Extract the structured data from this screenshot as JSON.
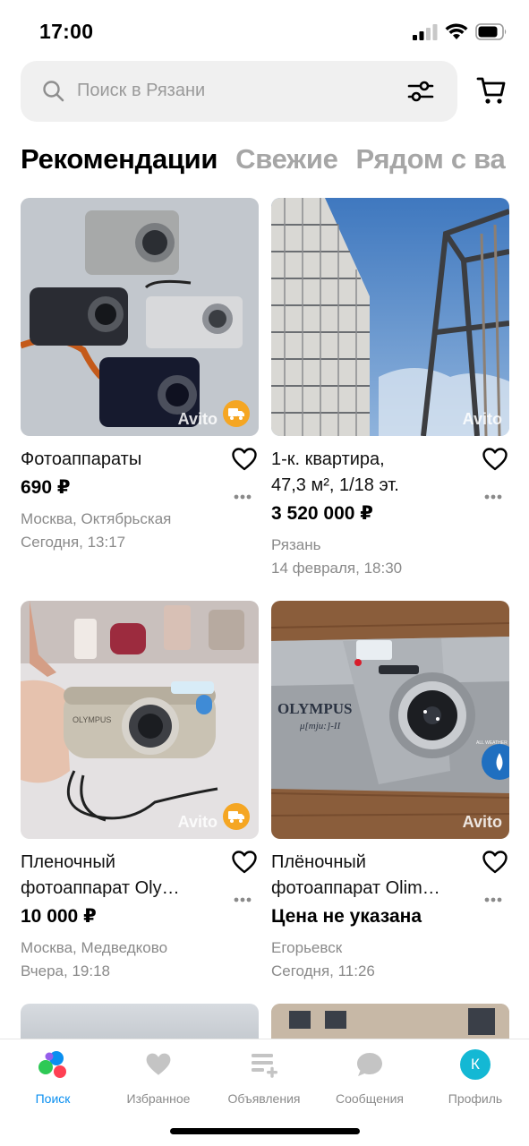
{
  "status_bar": {
    "time": "17:00"
  },
  "search": {
    "placeholder": "Поиск в Рязани"
  },
  "tabs": [
    {
      "label": "Рекомендации",
      "active": true
    },
    {
      "label": "Свежие",
      "active": false
    },
    {
      "label": "Рядом с ва",
      "active": false
    }
  ],
  "listings": [
    {
      "title_lines": [
        "Фотоаппараты"
      ],
      "price": "690 ₽",
      "location": "Москва, Октябрьская",
      "date": "Сегодня, 13:17",
      "delivery": true,
      "watermark": "Avito"
    },
    {
      "title_lines": [
        "1-к. квартира,",
        "47,3 м², 1/18 эт."
      ],
      "price": "3 520 000 ₽",
      "location": "Рязань",
      "date": "14 февраля, 18:30",
      "delivery": false,
      "watermark": "Avito"
    },
    {
      "title_lines": [
        "Пленочный",
        "фотоаппарат Oly…"
      ],
      "price": "10 000 ₽",
      "location": "Москва, Медведково",
      "date": "Вчера, 19:18",
      "delivery": true,
      "watermark": "Avito",
      "camera_brand": "OLYMPUS"
    },
    {
      "title_lines": [
        "Плёночный",
        "фотоаппарат Olim…"
      ],
      "price": "Цена не указана",
      "location": "Егорьевск",
      "date": "Сегодня, 11:26",
      "delivery": false,
      "watermark": "Avito",
      "camera_brand": "OLYMPUS",
      "camera_model": "μ[mju:]-II",
      "camera_badge": "ALL WEATHER"
    }
  ],
  "bottom_nav": [
    {
      "label": "Поиск",
      "icon": "search-dots-icon",
      "active": true
    },
    {
      "label": "Избранное",
      "icon": "heart-icon",
      "active": false
    },
    {
      "label": "Объявления",
      "icon": "listings-add-icon",
      "active": false
    },
    {
      "label": "Сообщения",
      "icon": "chat-bubble-icon",
      "active": false
    },
    {
      "label": "Профиль",
      "icon": "avatar",
      "active": false,
      "avatar_letter": "К"
    }
  ],
  "colors": {
    "accent_blue": "#0a8ff0",
    "delivery_orange": "#f5a623",
    "muted_text": "#8a8a8a",
    "search_bg": "#f0f0f0",
    "profile_avatar": "#14b8d4"
  }
}
